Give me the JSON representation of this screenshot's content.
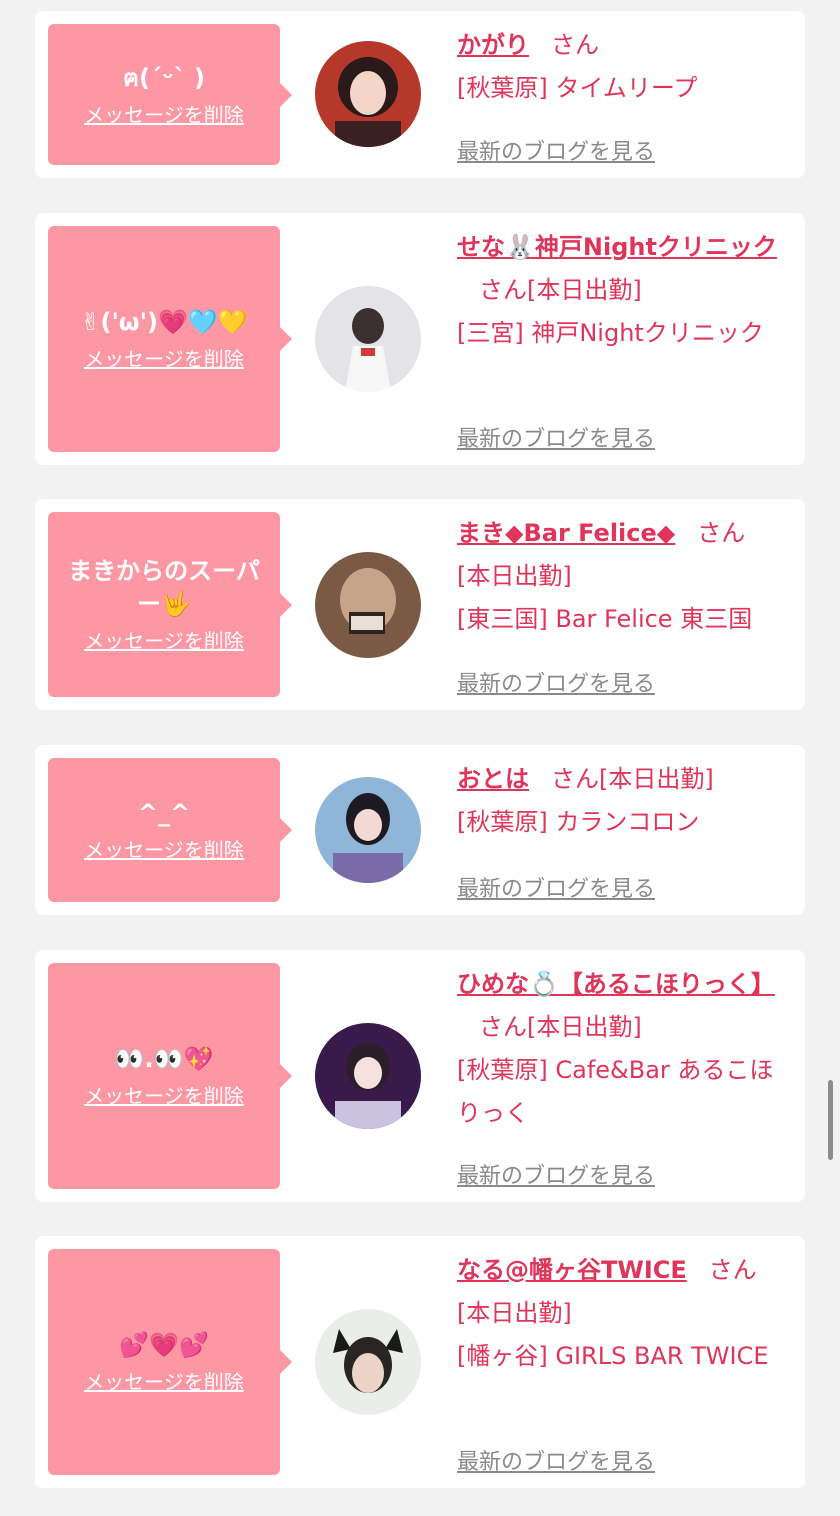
{
  "delete_label": "メッセージを削除",
  "blog_label": "最新のブログを見る",
  "san_label": "さん",
  "cards": [
    {
      "message": "ฅ(ˊᵕˋ )",
      "name": "かがり",
      "status": "",
      "location": "[秋葉原] タイムリープ"
    },
    {
      "message": "✌︎('ω')💗🩵💛",
      "name": "せな🐰神戸Nightクリニック",
      "status": "[本日出勤]",
      "location": "[三宮] 神戸Nightクリニック"
    },
    {
      "message": "まきからのスーパー🤟",
      "name": "まき◆Bar Felice◆",
      "status": "[本日出勤]",
      "location": "[東三国] Bar Felice 東三国"
    },
    {
      "message": "^_^",
      "name": "おとは",
      "status": "[本日出勤]",
      "location": "[秋葉原] カランコロン"
    },
    {
      "message": "👀.👀💖",
      "name": "ひめな💍【あるこほりっく】",
      "status": "[本日出勤]",
      "location": "[秋葉原] Cafe&Bar あるこほりっく"
    },
    {
      "message": "💕💗💕",
      "name": "なる@幡ヶ谷TWICE",
      "status": "[本日出勤]",
      "location": "[幡ヶ谷] GIRLS BAR TWICE"
    }
  ],
  "colors": {
    "background": "#f2f2f2",
    "card": "#ffffff",
    "bubble": "#fd97a3",
    "accent": "#e0355a",
    "link_gray": "#8a8a8a"
  }
}
